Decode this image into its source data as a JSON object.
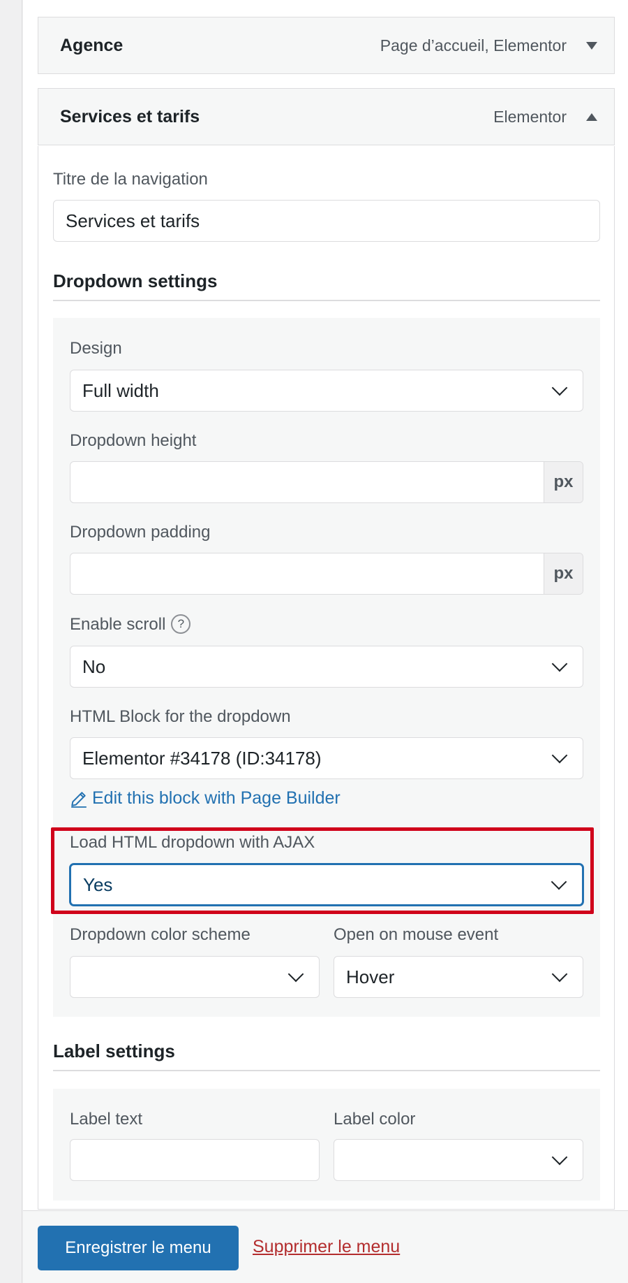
{
  "menu_items": [
    {
      "title": "Agence",
      "type": "Page d’accueil, Elementor"
    },
    {
      "title": "Services et tarifs",
      "type": "Elementor"
    }
  ],
  "navigation_label": {
    "label": "Titre de la navigation",
    "value": "Services et tarifs"
  },
  "dropdown_settings": {
    "title": "Dropdown settings",
    "design": {
      "label": "Design",
      "value": "Full width"
    },
    "height": {
      "label": "Dropdown height",
      "value": "",
      "unit": "px"
    },
    "padding": {
      "label": "Dropdown padding",
      "value": "",
      "unit": "px"
    },
    "enable_scroll": {
      "label": "Enable scroll",
      "help": "?",
      "value": "No"
    },
    "html_block": {
      "label": "HTML Block for the dropdown",
      "value": "Elementor #34178 (ID:34178)"
    },
    "edit_link": "Edit this block with Page Builder",
    "ajax": {
      "label": "Load HTML dropdown with AJAX",
      "value": "Yes"
    },
    "color_scheme": {
      "label": "Dropdown color scheme",
      "value": ""
    },
    "mouse_event": {
      "label": "Open on mouse event",
      "value": "Hover"
    }
  },
  "label_settings": {
    "title": "Label settings",
    "label_text": {
      "label": "Label text",
      "value": ""
    },
    "label_color": {
      "label": "Label color",
      "value": ""
    }
  },
  "footer": {
    "save_label": "Enregistrer le menu",
    "delete_label": "Supprimer le menu"
  },
  "colors": {
    "primary": "#2271b1",
    "danger": "#b32d2e",
    "highlight": "#d0021b"
  }
}
